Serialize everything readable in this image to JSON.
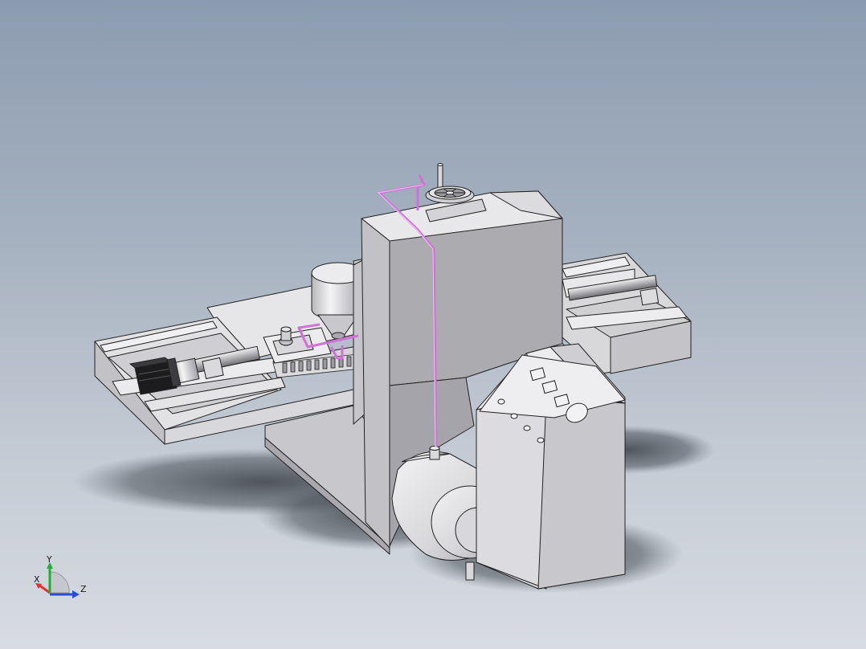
{
  "viewport": {
    "background_top": "#8c9cb0",
    "background_bottom": "#d8dce2",
    "part_fill": "#e4e4e6",
    "part_stroke": "#222222",
    "pipe_color": "#d070d8"
  },
  "triad": {
    "x_label": "X",
    "y_label": "Y",
    "z_label": "Z",
    "x_color": "#e03030",
    "y_color": "#20b030",
    "z_color": "#2a4ad8"
  }
}
